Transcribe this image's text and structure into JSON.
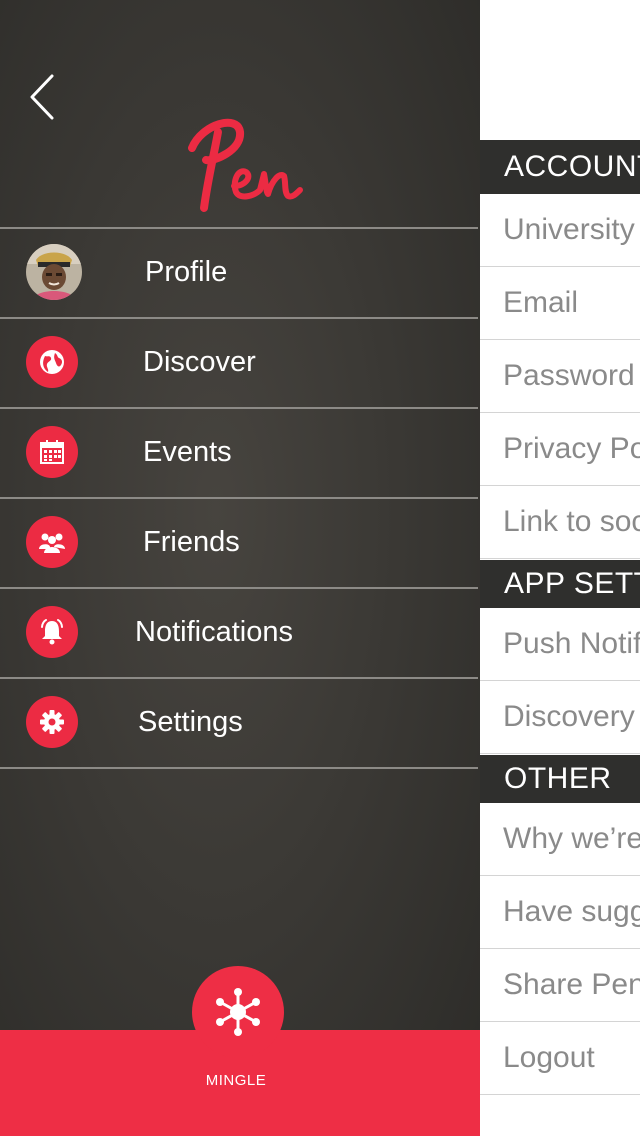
{
  "menu": {
    "items": [
      {
        "label": "Profile",
        "icon": "avatar"
      },
      {
        "label": "Discover",
        "icon": "globe-icon"
      },
      {
        "label": "Events",
        "icon": "calendar-icon"
      },
      {
        "label": "Friends",
        "icon": "friends-icon"
      },
      {
        "label": "Notifications",
        "icon": "bell-icon"
      },
      {
        "label": "Settings",
        "icon": "gear-icon"
      }
    ],
    "mingle_label": "MINGLE",
    "accent_color": "#ec2b43"
  },
  "settings": {
    "account_header": "ACCOUNT",
    "account_rows": [
      "University",
      "Email",
      "Password",
      "Privacy Po",
      "Link to soc"
    ],
    "app_header": "APP SETTI",
    "app_rows": [
      "Push Notif",
      "Discovery"
    ],
    "other_header": "OTHER",
    "other_rows": [
      "Why we’re",
      "Have sugg",
      "Share PenP",
      "Logout"
    ]
  }
}
